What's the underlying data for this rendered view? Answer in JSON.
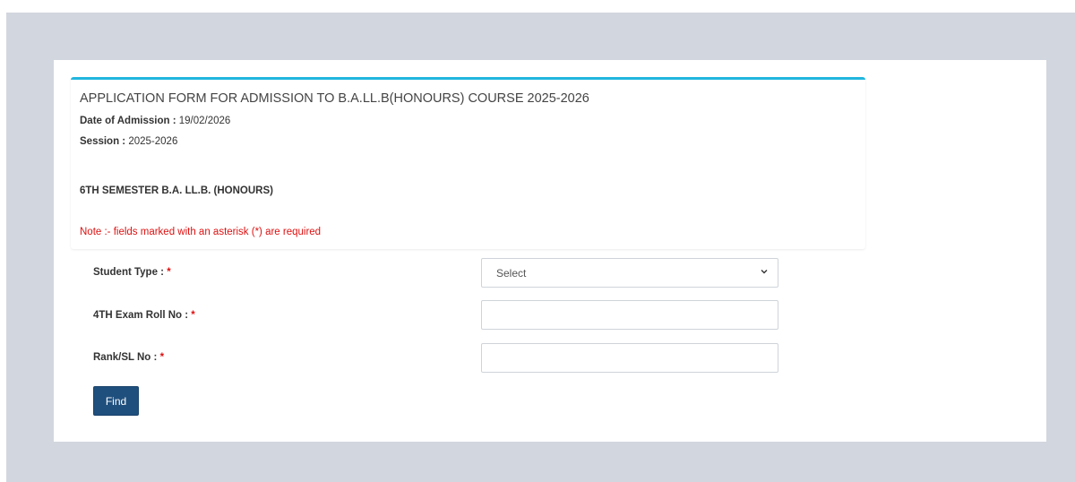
{
  "form": {
    "title": "APPLICATION FORM FOR ADMISSION TO B.A.LL.B(HONOURS) COURSE 2025-2026",
    "date_label": "Date of Admission :",
    "date_value": "19/02/2026",
    "session_label": "Session :",
    "session_value": "2025-2026",
    "semester": "6TH SEMESTER B.A. LL.B. (HONOURS)",
    "note": "Note :- fields marked with an asterisk (*) are required"
  },
  "fields": {
    "student_type_label": "Student Type :",
    "student_type_value": "Select",
    "roll_label": "4TH Exam Roll No :",
    "roll_value": "",
    "rank_label": "Rank/SL No :",
    "rank_value": "",
    "required_mark": "*"
  },
  "actions": {
    "find_label": "Find"
  },
  "colors": {
    "accent": "#21b6de",
    "button": "#1f4f7d",
    "required": "#dd1111",
    "background": "#d2d6de"
  },
  "icons": {
    "select_arrow": "chevron-down-icon"
  }
}
